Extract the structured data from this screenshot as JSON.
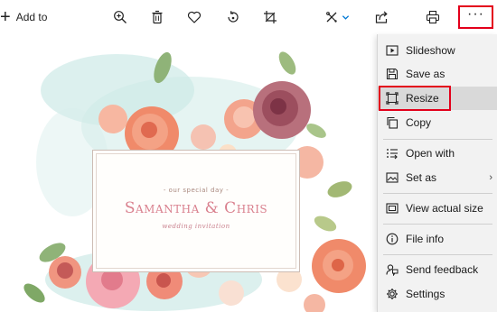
{
  "toolbar": {
    "add_to_label": "Add to",
    "icons": [
      "zoom-in-icon",
      "delete-icon",
      "favorite-icon",
      "rotate-icon",
      "crop-icon",
      "edit-icon",
      "share-icon",
      "print-icon",
      "more-icon"
    ],
    "more_label": "···"
  },
  "card": {
    "tagline": "- our special day -",
    "names": "Samantha & Chris",
    "subtitle": "wedding invitation"
  },
  "menu": {
    "items": [
      {
        "label": "Slideshow",
        "icon": "slideshow-icon"
      },
      {
        "label": "Save as",
        "icon": "save-icon"
      },
      {
        "label": "Resize",
        "icon": "resize-icon"
      },
      {
        "label": "Copy",
        "icon": "copy-icon"
      },
      {
        "label": "Open with",
        "icon": "open-with-icon"
      },
      {
        "label": "Set as",
        "icon": "set-as-icon"
      },
      {
        "label": "View actual size",
        "icon": "actual-size-icon"
      },
      {
        "label": "File info",
        "icon": "info-icon"
      },
      {
        "label": "Send feedback",
        "icon": "feedback-icon"
      },
      {
        "label": "Settings",
        "icon": "settings-icon"
      }
    ],
    "set_as_chevron": "›"
  },
  "colors": {
    "highlight_border": "#e3001b",
    "menu_bg": "#f2f2f2",
    "hover_bg": "#d9d9d9",
    "accent_blue": "#0078d4"
  }
}
